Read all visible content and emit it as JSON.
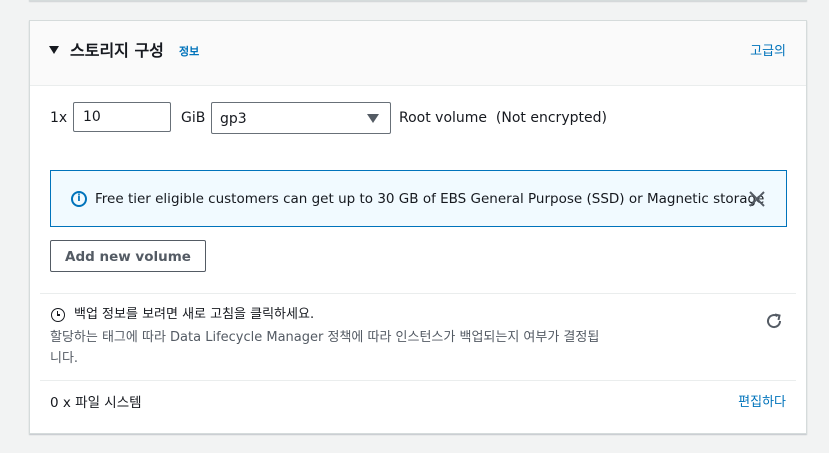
{
  "header": {
    "title": "스토리지 구성",
    "info_link": "정보",
    "advanced_link": "고급의"
  },
  "volume": {
    "count_prefix": "1x",
    "size_value": "10",
    "unit": "GiB",
    "type_selected": "gp3",
    "description": "Root volume  (Not encrypted)"
  },
  "alert": {
    "icon": "info-icon",
    "message": "Free tier eligible customers can get up to 30 GB of EBS General Purpose (SSD) or Magnetic storage",
    "close_icon": "close-icon"
  },
  "add_volume_label": "Add new volume",
  "backup": {
    "icon": "clock-icon",
    "title": "백업 정보를 보려면 새로 고침을 클릭하세요.",
    "description": "할당하는 태그에 따라 Data Lifecycle Manager 정책에 따라 인스턴스가 백업되는지 여부가 결정됩니다.",
    "refresh_icon": "refresh-icon"
  },
  "file_systems": {
    "label": "0 x 파일 시스템",
    "edit_link": "편집하다"
  },
  "colors": {
    "link": "#0073bb",
    "alert_bg": "#f1faff",
    "alert_border": "#0073bb",
    "text": "#16191f",
    "secondary_text": "#545b64"
  }
}
